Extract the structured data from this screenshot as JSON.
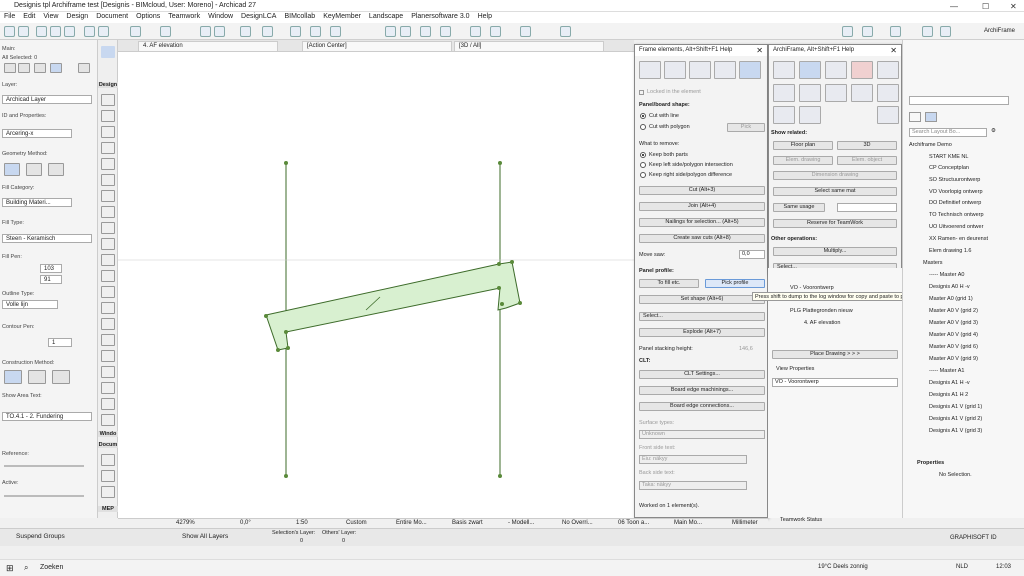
{
  "window": {
    "title": "Designis tpl Archiframe test [Designis - BIMcloud, User: Moreno] - Archicad 27"
  },
  "menu": [
    "File",
    "Edit",
    "View",
    "Design",
    "Document",
    "Options",
    "Teamwork",
    "Window",
    "DesignLCA",
    "BIMcollab",
    "KeyMember",
    "Landscape",
    "Planersoftware 3.0",
    "Help"
  ],
  "toolbar_right": {
    "brand": "ArchiFrame"
  },
  "info_box": {
    "main": "Main:",
    "all_selected": "All Selected: 0",
    "layer_label": "Layer:",
    "layer_value": "Archicad Layer",
    "id_label": "ID and Properties:",
    "id_value": "Arcering-x",
    "geometry_label": "Geometry Method:",
    "fill_category_label": "Fill Category:",
    "fill_category_value": "Building Materi...",
    "fill_type_label": "Fill Type:",
    "fill_type_value": "Steen - Keramisch",
    "fill_pen_label": "Fill Pen:",
    "pen1": "103",
    "pen2": "91",
    "outline_label": "Outline Type:",
    "outline_value": "Volle lijn",
    "contour_label": "Contour Pen:",
    "contour_value": "1",
    "construction_label": "Construction Method:",
    "area_text_label": "Show Area Text:",
    "area_text_value": "TO.4.1 - 2. Fundering",
    "reference_label": "Reference:",
    "active_label": "Active:"
  },
  "toolbox": {
    "design": "Design",
    "window": "Windo",
    "document": "Docum",
    "mep": "MEP"
  },
  "tabs": [
    {
      "label": "4. AF elevation"
    },
    {
      "label": "[Action Center]"
    },
    {
      "label": "[3D / All]"
    }
  ],
  "frame_dialog": {
    "title": "Frame elements, Alt+Shift+F1 Help",
    "locked": "Locked in the element",
    "shape_header": "Panel/board shape:",
    "cut_with_line": "Cut with line",
    "cut_with_polygon": "Cut with polygon",
    "pick": "Pick",
    "remove_header": "What to remove:",
    "keep_both": "Keep both parts",
    "keep_left": "Keep left side/polygon intersection",
    "keep_right": "Keep right side/polygon difference",
    "cut_btn": "Cut (Alt+3)",
    "join_btn": "Join (Alt+4)",
    "nailings_btn": "Nailings for selection... (Alt+5)",
    "saw_cuts_btn": "Create saw cuts (Alt+8)",
    "move_saw_label": "Move saw:",
    "move_saw_value": "0,0",
    "profile_header": "Panel profile:",
    "to_fill_btn": "To fill etc.",
    "pick_profile_btn": "Pick profile",
    "set_shape_btn": "Set shape (Alt+6)",
    "select_btn": "Select...",
    "explode_btn": "Explode (Alt+7)",
    "stacking_label": "Panel stacking height:",
    "stacking_value": "146,6",
    "clt_header": "CLT:",
    "clt_settings_btn": "CLT Settings...",
    "board_edge_mach_btn": "Board edge machinings...",
    "board_edge_conn_btn": "Board edge connections...",
    "surface_label": "Surface types:",
    "surface_value": "Unknown",
    "front_label": "Front side text:",
    "front_value": "Eiu: näkyy",
    "back_label": "Back side text:",
    "back_value": "Taka: näkyy",
    "status": "Worked on 1 element(s)."
  },
  "af_dialog": {
    "title": "ArchiFrame, Alt+Shift+F1 Help",
    "show_related": "Show related:",
    "floor_plan_btn": "Floor plan",
    "btn_3d": "3D",
    "elem_drawing_btn": "Elem. drawing",
    "elem_object_btn": "Elem. object",
    "dimension_btn": "Dimension drawing",
    "select_same_btn": "Select same mat",
    "same_usage_btn": "Same usage",
    "reserve_btn": "Reserve for TeamWork",
    "other_ops": "Other operations:",
    "multiply_btn": "Multiply...",
    "select_dd": "Select..."
  },
  "tooltip": "Press shift to dump to the log window for copy and paste to panel definitions xml-file.",
  "mid_panel": {
    "items": [
      "VO - Voorontwerp",
      "PLG Plattegronden slopen",
      "PLG Plattegronden nieuw",
      "4. AF elevation"
    ],
    "place_drawing": "Place Drawing > > >",
    "view_props": "View Properties",
    "view_value": "VO - Voorontwerp",
    "teamwork": "Teamwork Status"
  },
  "navigator": {
    "search_placeholder": "Search Layout Bo...",
    "items": [
      "Archiframe Demo",
      "START KME NL",
      "CP Conceptplan",
      "SO Structuurontwerp",
      "VO Voorlopig ontwerp",
      "DO Definitief ontwerp",
      "TO Technisch ontwerp",
      "UO Uitvoerend ontwer",
      "XX Ramen- en deurenst",
      "Elem drawing 1.6",
      "Masters",
      "----- Master A0",
      "Designis A0 H -v",
      "Master A0 (grid 1)",
      "Master A0 V (grid 2)",
      "Master A0 V (grid 3)",
      "Master A0 V (grid 4)",
      "Master A0 V (grid 6)",
      "Master A0 V (grid 9)",
      "----- Master A1",
      "Designis A1 H -v",
      "Designis A1 H 2",
      "Designis A1 V (grid 1)",
      "Designis A1 V (grid 2)",
      "Designis A1 V (grid 3)"
    ],
    "properties_header": "Properties",
    "no_selection": "No Selection."
  },
  "statusbar": {
    "zoom": "4279%",
    "angle": "0,0°",
    "scale": "1:50",
    "custom": "Custom",
    "model": "Entire Mo...",
    "basis": "Basis zwart",
    "modell": "- Modell...",
    "override": "No Overri...",
    "toon": "06 Toon a...",
    "main": "Main Mo...",
    "units": "Millimeter"
  },
  "bottombar": {
    "suspend": "Suspend Groups",
    "show_layers": "Show All Layers",
    "selections_layer": "Selection's Layer:",
    "others_layer": "Others' Layer:",
    "zero": "0",
    "graphisoft": "GRAPHISOFT ID"
  },
  "taskbar": {
    "search": "Zoeken",
    "weather": "19°C  Deels zonnig",
    "lang": "NLD",
    "time": "12:03"
  },
  "colors": {
    "frame_fill": "#d8f0d0",
    "frame_stroke": "#3d6b2a",
    "accent": "#1a73e8"
  }
}
